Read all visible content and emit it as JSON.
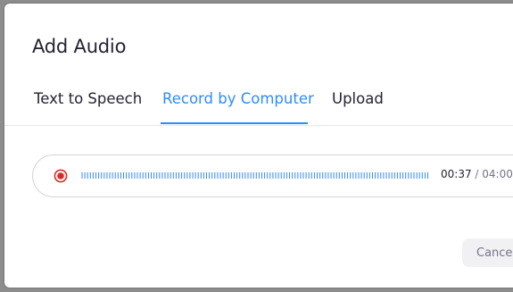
{
  "dialog": {
    "title": "Add Audio"
  },
  "tabs": [
    {
      "label": "Text to Speech",
      "active": false
    },
    {
      "label": "Record by Computer",
      "active": true
    },
    {
      "label": "Upload",
      "active": false
    }
  ],
  "recorder": {
    "record_icon": "record-stop-icon",
    "elapsed": "00:37",
    "separator": " / ",
    "duration": "04:00"
  },
  "footer": {
    "cancel_label": "Cancel"
  },
  "colors": {
    "accent": "#2d8cff",
    "record": "#e02828",
    "text": "#232333",
    "muted": "#747487"
  }
}
